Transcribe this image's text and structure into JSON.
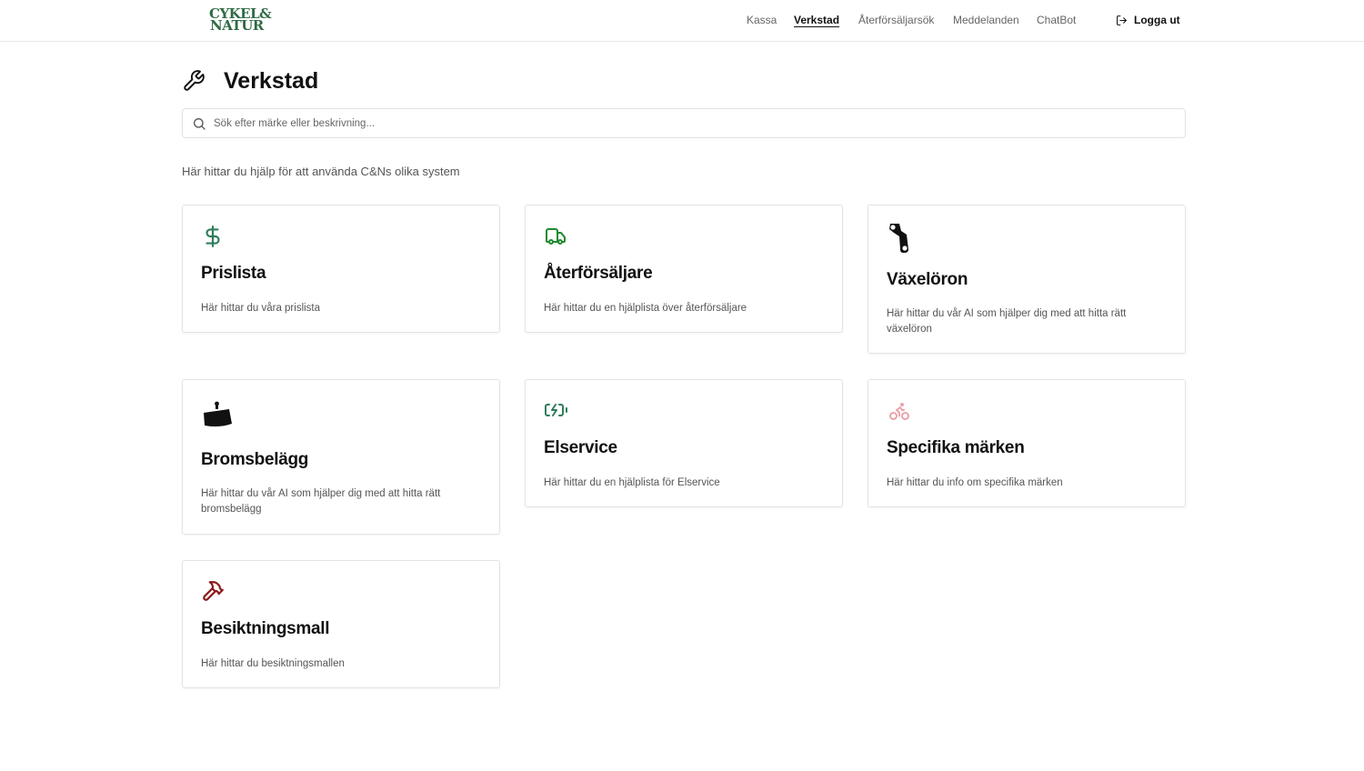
{
  "brand": {
    "line1": "CYKEL&",
    "line2": "NATUR"
  },
  "nav": {
    "items": [
      {
        "label": "Kassa"
      },
      {
        "label": "Verkstad",
        "active": true
      },
      {
        "label": "Återförsäljarsök"
      },
      {
        "label": "Meddelanden"
      },
      {
        "label": "ChatBot"
      }
    ],
    "logout_label": "Logga ut",
    "logout_icon": "logout-icon"
  },
  "page": {
    "title": "Verkstad",
    "title_icon": "wrench-icon",
    "search_placeholder": "Sök efter märke eller beskrivning...",
    "intro": "Här hittar du hjälp för att använda C&Ns olika system"
  },
  "colors": {
    "brand_green": "#2f6b45",
    "dollar_icon": "#2f7d5b",
    "truck_icon": "#1e8a2e",
    "battery_icon": "#2f7d5b",
    "bike_icon": "#e8a3aa",
    "hammer_icon": "#8b1a1a"
  },
  "cards": [
    {
      "title": "Prislista",
      "description": "Här hittar du våra prislista",
      "icon": "dollar-icon"
    },
    {
      "title": "Återförsäljare",
      "description": "Här hittar du en hjälplista över återförsäljare",
      "icon": "truck-icon"
    },
    {
      "title": "Växelöron",
      "description": "Här hittar du vår AI som hjälper dig med att hitta rätt växelöron",
      "icon": "derailleur-hanger-icon"
    },
    {
      "title": "Bromsbelägg",
      "description": "Här hittar du vår AI som hjälper dig med att hitta rätt bromsbelägg",
      "icon": "brake-pad-icon"
    },
    {
      "title": "Elservice",
      "description": "Här hittar du en hjälplista för Elservice",
      "icon": "battery-charging-icon"
    },
    {
      "title": "Specifika märken",
      "description": "Här hittar du info om specifika märken",
      "icon": "bike-icon"
    },
    {
      "title": "Besiktningsmall",
      "description": "Här hittar du besiktningsmallen",
      "icon": "hammer-icon"
    }
  ]
}
